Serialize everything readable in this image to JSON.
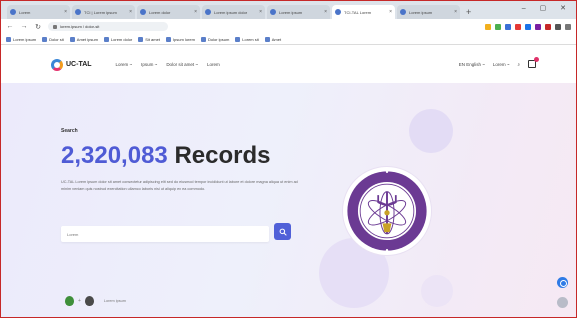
{
  "browser": {
    "tabs": [
      {
        "title": "Lorem"
      },
      {
        "title": "TCI | Lorem ipsum"
      },
      {
        "title": "Lorem dolor"
      },
      {
        "title": "Lorem ipsum dolor"
      },
      {
        "title": "Lorem ipsum"
      },
      {
        "title": "TCI-TAL Lorem"
      },
      {
        "title": "Lorem ipsum"
      }
    ],
    "active_tab_index": 5,
    "new_tab_label": "+",
    "window_controls": "–  ▢  ✕",
    "address": "lorem.ipsum / dolor-sit",
    "bookmarks": [
      "Lorem ipsum",
      "Dolor sit",
      "Amet ipsum",
      "Lorem dolor",
      "Sit amet",
      "Ipsum lorem",
      "Dolor ipsum",
      "Lorem sit",
      "Amet"
    ]
  },
  "header": {
    "logo_text": "UC-TAL",
    "nav": [
      "Lorem ~",
      "Ipsum ~",
      "Dolor sit amet ~",
      "Lorem"
    ],
    "language": "EN English ~",
    "user": "Lorem ~"
  },
  "hero": {
    "search_label": "Search",
    "count": "2,320,083",
    "count_word": "Records",
    "description": "UC-TAL Lorem ipsum dolor sit amet consectetur adipiscing elit sed do eiusmod tempor incididunt ut labore et dolore magna aliqua ut enim ad minim veniam quis nostrud exercitation ullamco laboris nisi ut aliquip ex ea commodo.",
    "search_placeholder": "Lorem",
    "partners_text": "Lorem ipsum"
  },
  "colors": {
    "accent": "#4f5bd5",
    "frame": "#c62828"
  }
}
